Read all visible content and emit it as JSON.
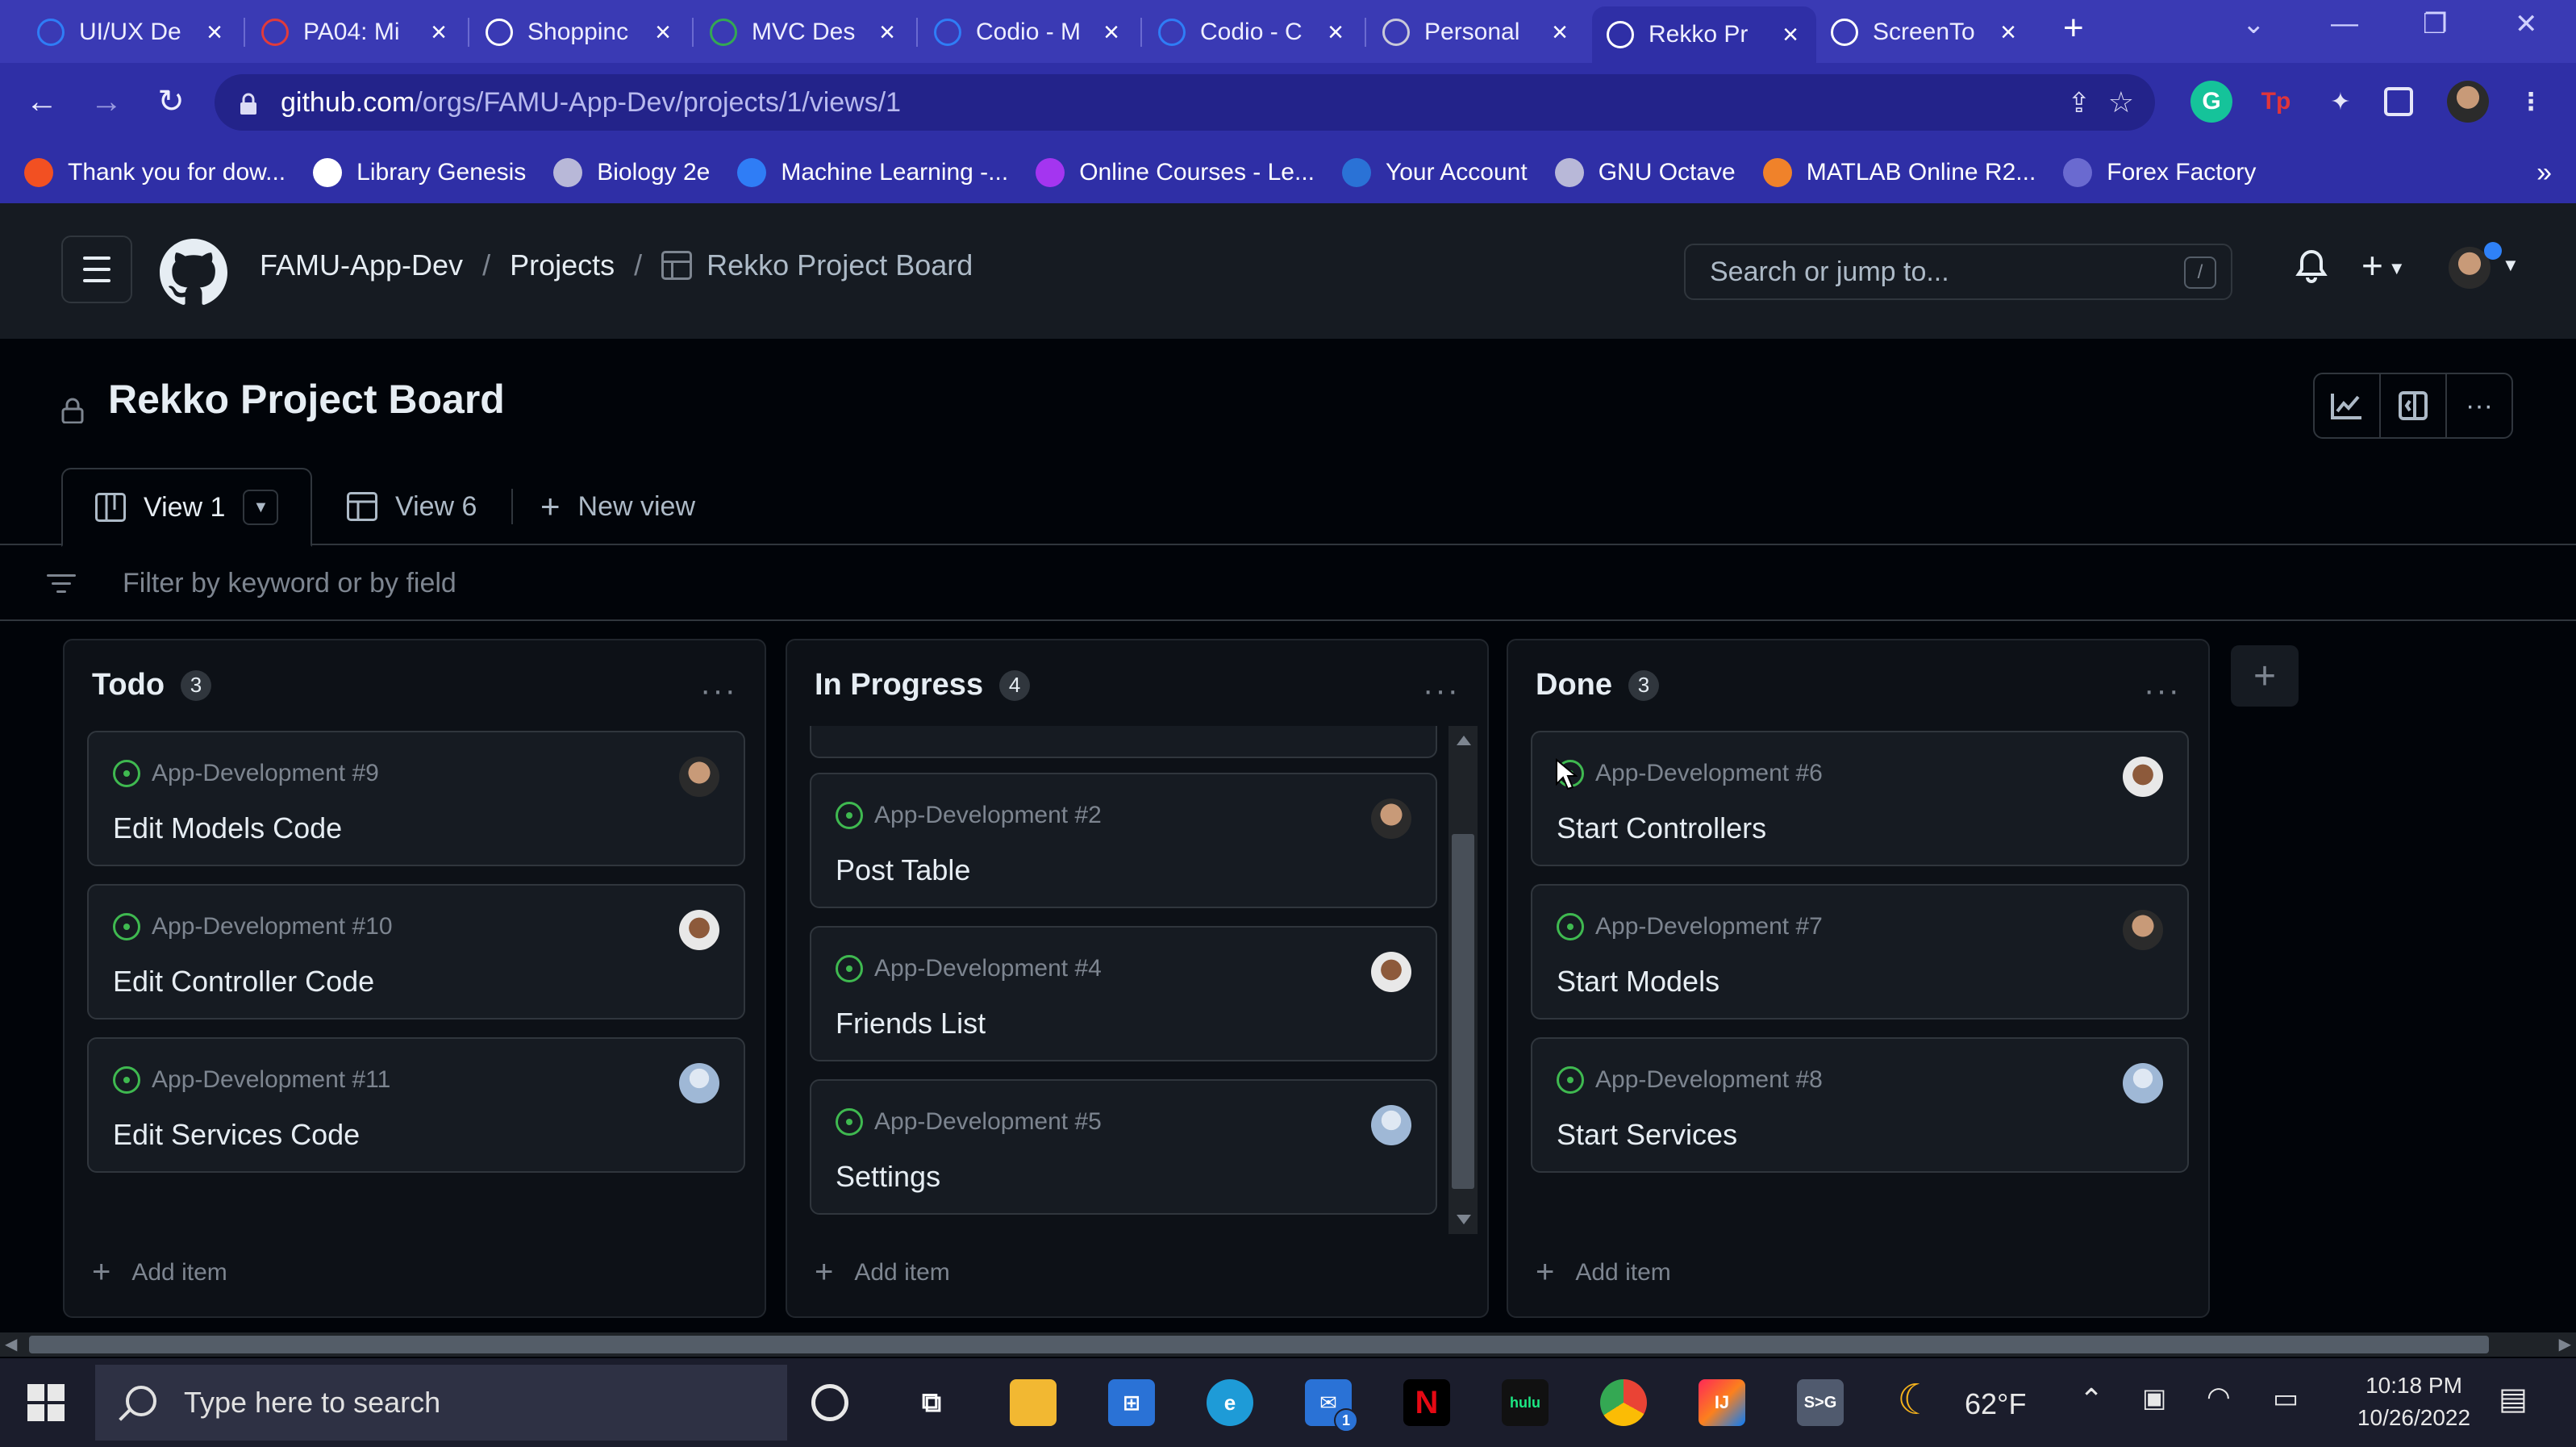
{
  "browser": {
    "tabs": [
      {
        "label": "UI/UX De",
        "icon": "codio-icon",
        "color": "#2f7df6"
      },
      {
        "label": "PA04: Mi",
        "icon": "canvas-icon",
        "color": "#e13b3b"
      },
      {
        "label": "Shoppinc",
        "icon": "document-icon",
        "color": "#ffffff"
      },
      {
        "label": "MVC Des",
        "icon": "link-icon",
        "color": "#34a853"
      },
      {
        "label": "Codio - M",
        "icon": "codio-icon",
        "color": "#2f7df6"
      },
      {
        "label": "Codio - C",
        "icon": "codio-icon",
        "color": "#2f7df6"
      },
      {
        "label": "Personal",
        "icon": "globe-icon",
        "color": "#c9c9d9"
      },
      {
        "label": "Rekko Pr",
        "icon": "github-icon",
        "color": "#ffffff",
        "active": true
      },
      {
        "label": "ScreenTo",
        "icon": "monitor-icon",
        "color": "#ffffff"
      }
    ],
    "url_host": "github.com",
    "url_path": "/orgs/FAMU-App-Dev/projects/1/views/1",
    "bookmarks": [
      {
        "label": "Thank you for dow...",
        "icon": "windows-icon"
      },
      {
        "label": "Library Genesis",
        "icon": "book-icon"
      },
      {
        "label": "Biology 2e",
        "icon": "globe-icon"
      },
      {
        "label": "Machine Learning -...",
        "icon": "coursera-icon"
      },
      {
        "label": "Online Courses - Le...",
        "icon": "udemy-icon"
      },
      {
        "label": "Your Account",
        "icon": "account-icon"
      },
      {
        "label": "GNU Octave",
        "icon": "globe-icon"
      },
      {
        "label": "MATLAB Online R2...",
        "icon": "matlab-icon"
      },
      {
        "label": "Forex Factory",
        "icon": "forex-icon"
      }
    ],
    "more_bookmarks": "»"
  },
  "github": {
    "org": "FAMU-App-Dev",
    "projects": "Projects",
    "project_name": "Rekko Project Board",
    "search_placeholder": "Search or jump to...",
    "search_key": "/"
  },
  "project": {
    "title": "Rekko Project Board",
    "views": [
      {
        "label": "View 1",
        "active": true
      },
      {
        "label": "View 6"
      },
      {
        "label": "New view"
      }
    ],
    "filter_placeholder": "Filter by keyword or by field"
  },
  "board": {
    "add_item": "Add item",
    "columns": [
      {
        "name": "Todo",
        "count": "3",
        "cards": [
          {
            "ref": "App-Development #9",
            "title": "Edit Models Code",
            "avatar": "a"
          },
          {
            "ref": "App-Development #10",
            "title": "Edit Controller Code",
            "avatar": "b"
          },
          {
            "ref": "App-Development #11",
            "title": "Edit Services Code",
            "avatar": "c"
          }
        ]
      },
      {
        "name": "In Progress",
        "count": "4",
        "cards": [
          {
            "ref": "App-Development #2",
            "title": "Post Table",
            "avatar": "a"
          },
          {
            "ref": "App-Development #4",
            "title": "Friends List",
            "avatar": "b"
          },
          {
            "ref": "App-Development #5",
            "title": "Settings",
            "avatar": "c"
          }
        ]
      },
      {
        "name": "Done",
        "count": "3",
        "cards": [
          {
            "ref": "App-Development #6",
            "title": "Start Controllers",
            "avatar": "b"
          },
          {
            "ref": "App-Development #7",
            "title": "Start Models",
            "avatar": "a"
          },
          {
            "ref": "App-Development #8",
            "title": "Start Services",
            "avatar": "c"
          }
        ]
      }
    ]
  },
  "taskbar": {
    "search_placeholder": "Type here to search",
    "weather": "62°F",
    "time": "10:18 PM",
    "date": "10/26/2022",
    "mail_badge": "1"
  }
}
